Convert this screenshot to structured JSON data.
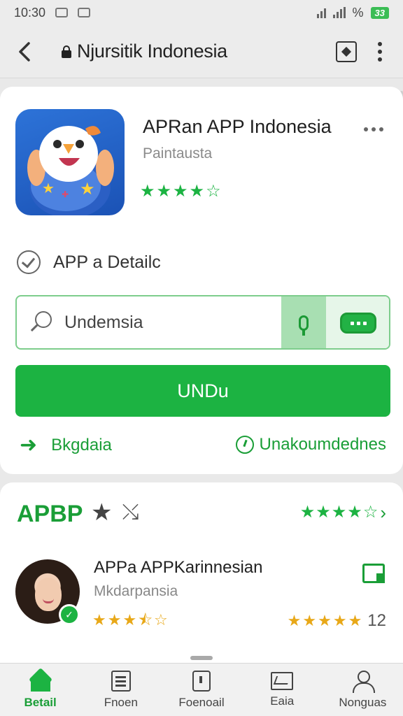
{
  "status_bar": {
    "time": "10:30",
    "battery": "33",
    "signal_text": "%"
  },
  "top_bar": {
    "title": "Njursitik Indonesia"
  },
  "app_card": {
    "name": "APRan APP Indonesia",
    "subtitle": "Paintausta",
    "rating_stars": 4,
    "detail_label": "APP a Detailc",
    "search": {
      "value": "Undemsia",
      "placeholder": ""
    },
    "install_label": "UNDu",
    "left_link": "Bkgdaia",
    "right_link": "Unakoumdednes"
  },
  "review": {
    "title": "APBP",
    "rating_stars": 4,
    "reviewer": {
      "name": "APPa APPKarinnesian",
      "subtitle": "Mkdarpansia",
      "stars": 3.5,
      "count": "12",
      "count_stars": 5
    }
  },
  "bottom_nav": [
    {
      "label": "Betail",
      "icon": "home-icon",
      "active": true
    },
    {
      "label": "Fnoen",
      "icon": "list-icon",
      "active": false
    },
    {
      "label": "Foenoail",
      "icon": "bag-icon",
      "active": false
    },
    {
      "label": "Eaia",
      "icon": "flag-icon",
      "active": false
    },
    {
      "label": "Nonguas",
      "icon": "person-icon",
      "active": false
    }
  ],
  "colors": {
    "accent": "#1cb342",
    "accent_dark": "#1a9e37",
    "star_yellow": "#e8a818",
    "app_icon_blue": "#2d73d8"
  }
}
